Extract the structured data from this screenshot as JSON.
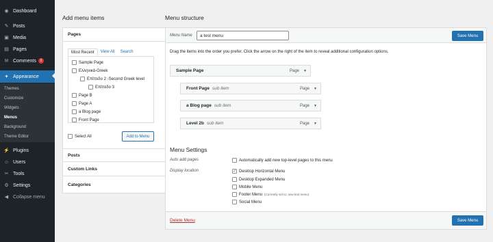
{
  "sidebar": {
    "items": [
      {
        "label": "Dashboard",
        "icon": "dashboard-icon",
        "glyph": "◉"
      },
      {
        "label": "Posts",
        "icon": "pin-icon",
        "glyph": "✎"
      },
      {
        "label": "Media",
        "icon": "media-icon",
        "glyph": "▣"
      },
      {
        "label": "Pages",
        "icon": "pages-icon",
        "glyph": "▤"
      },
      {
        "label": "Comments",
        "icon": "comment-icon",
        "glyph": "✉",
        "badge": "3"
      },
      {
        "label": "Appearance",
        "icon": "brush-icon",
        "glyph": "✦"
      },
      {
        "label": "Plugins",
        "icon": "plug-icon",
        "glyph": "⚡"
      },
      {
        "label": "Users",
        "icon": "user-icon",
        "glyph": "☺"
      },
      {
        "label": "Tools",
        "icon": "wrench-icon",
        "glyph": "✂"
      },
      {
        "label": "Settings",
        "icon": "settings-icon",
        "glyph": "⚙"
      },
      {
        "label": "Collapse menu",
        "icon": "collapse-icon",
        "glyph": "◀"
      }
    ],
    "submenu": [
      "Themes",
      "Customize",
      "Widgets",
      "Menus",
      "Background",
      "Theme Editor"
    ]
  },
  "add_items": {
    "heading": "Add menu items",
    "pages_section": "Pages",
    "tabs": [
      "Most Recent",
      "View All",
      "Search"
    ],
    "pages": [
      "Sample Page",
      "Ελληνικά-Greek",
      "Επίπεδο 2 -Second Greek level",
      "Επίπεδο 3",
      "Page B",
      "Page A",
      "a Blog page",
      "Front Page"
    ],
    "select_all": "Select All",
    "add_button": "Add to Menu",
    "other_sections": [
      "Posts",
      "Custom Links",
      "Categories"
    ]
  },
  "structure": {
    "heading": "Menu structure",
    "menu_name_label": "Menu Name",
    "menu_name_value": "a test menu",
    "save_label": "Save Menu",
    "instructions": "Drag the items into the order you prefer. Click the arrow on the right of the item to reveal additional configuration options.",
    "items": [
      {
        "title": "Sample Page",
        "sub": "",
        "type": "Page"
      },
      {
        "title": "Front Page",
        "sub": "sub item",
        "type": "Page"
      },
      {
        "title": "a Blog page",
        "sub": "sub item",
        "type": "Page"
      },
      {
        "title": "Level 2b",
        "sub": "sub item",
        "type": "Page"
      }
    ],
    "settings_heading": "Menu Settings",
    "auto_add_label": "Auto add pages",
    "auto_add_text": "Automatically add new top-level pages to this menu",
    "display_location_label": "Display location",
    "locations": [
      {
        "label": "Desktop Horizontal Menu",
        "checked": true,
        "note": ""
      },
      {
        "label": "Desktop Expanded Menu",
        "checked": false,
        "note": ""
      },
      {
        "label": "Mobile Menu",
        "checked": false,
        "note": ""
      },
      {
        "label": "Footer Menu",
        "checked": false,
        "note": "(Currently set to: new test menu)"
      },
      {
        "label": "Social Menu",
        "checked": false,
        "note": ""
      }
    ],
    "delete_label": "Delete Menu"
  },
  "colors": {
    "accent": "#2271b1",
    "sidebar": "#1d2327",
    "danger": "#b32d2e"
  }
}
